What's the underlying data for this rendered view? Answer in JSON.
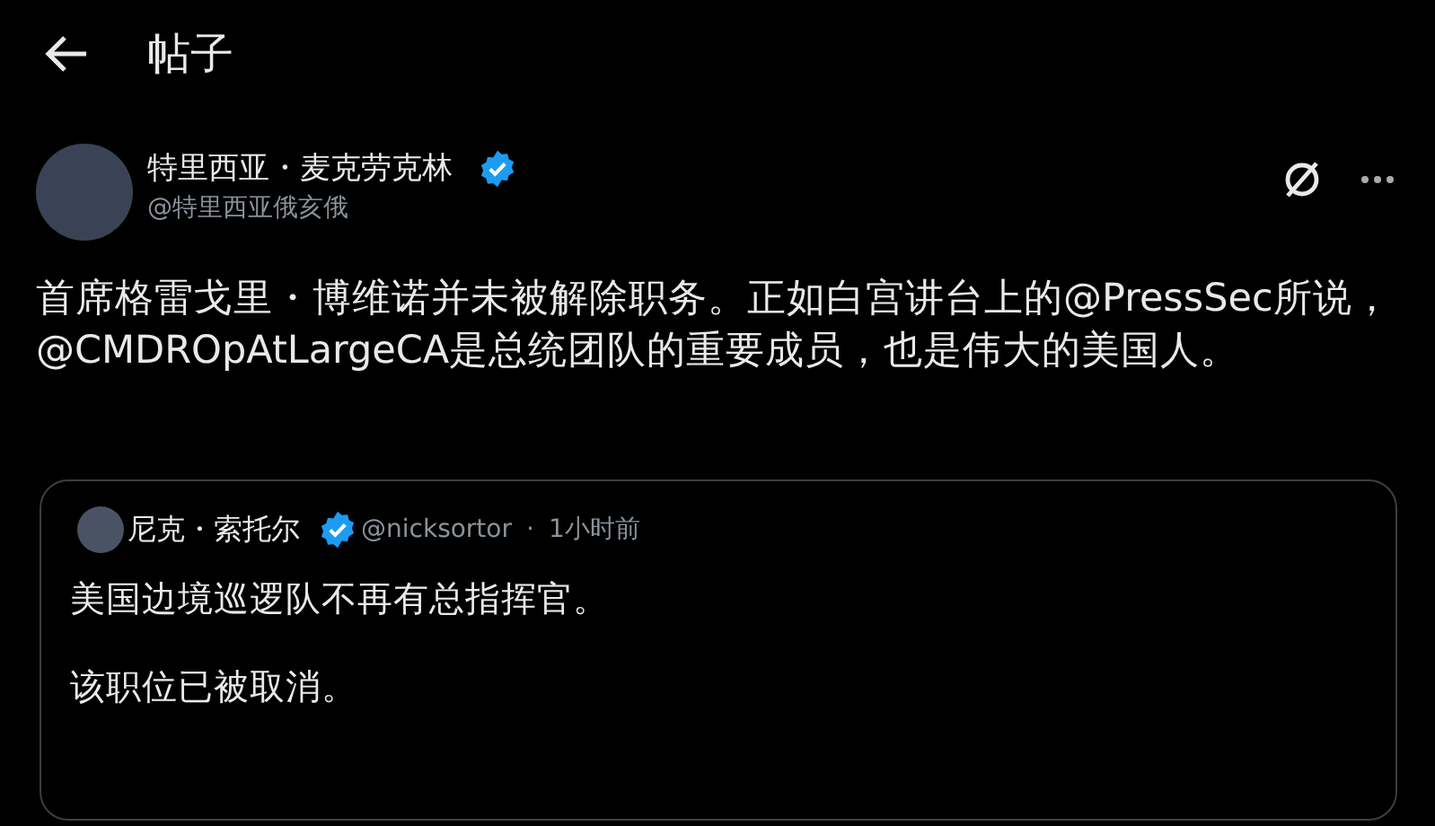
{
  "header": {
    "title": "帖子"
  },
  "post": {
    "author": {
      "name": "特里西亚・麦克劳克林",
      "handle": "@特里西亚俄亥俄",
      "verified": true
    },
    "text": "首席格雷戈里・博维诺并未被解除职务。正如白宫讲台上的@PressSec所说，@CMDROpAtLargeCA是总统团队的重要成员，也是伟大的美国人。",
    "quote": {
      "author": {
        "name": "尼克・索托尔",
        "handle": "@nicksortor",
        "verified": true
      },
      "separator": "·",
      "time": "1小时前",
      "paragraphs": [
        "美国边境巡逻队不再有总指挥官。",
        "该职位已被取消。"
      ]
    }
  }
}
